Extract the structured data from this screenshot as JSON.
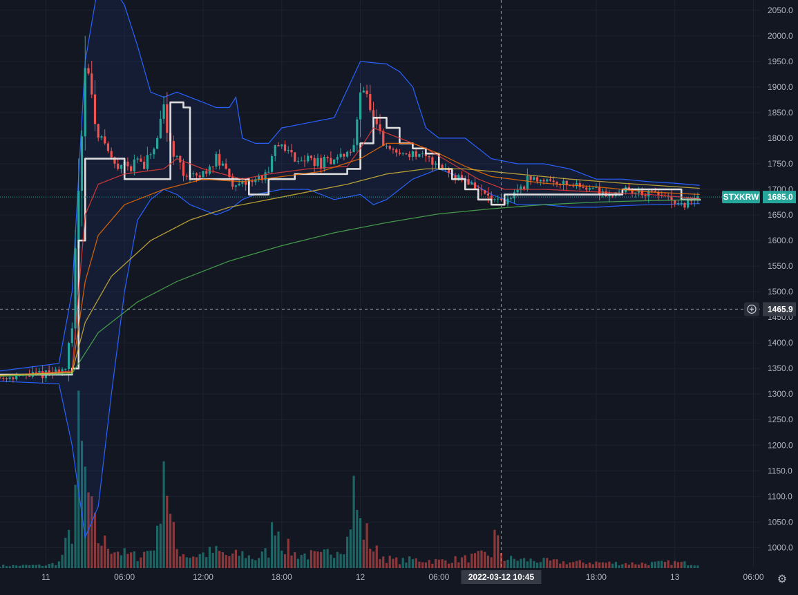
{
  "symbol": "STXKRW",
  "last_price_label": "1685.0",
  "crosshair": {
    "price_label": "1465.9",
    "time_label": "2022-03-12   10:45",
    "time_hours": 34.75
  },
  "colors": {
    "bg": "#131722",
    "grid": "#1e2230",
    "up": "#26a69a",
    "down": "#ef5350",
    "bb": "#2962ff",
    "symbol_badge": "#26a69a"
  },
  "icons": {
    "settings": "gear-icon",
    "crosshair_add": "plus-circle-icon"
  },
  "chart_data": {
    "type": "candlestick",
    "price_axis": {
      "ylim": [
        960,
        2070
      ],
      "ticks": [
        "2050.0",
        "2000.0",
        "1950.0",
        "1900.0",
        "1850.0",
        "1800.0",
        "1750.0",
        "1700.0",
        "1650.0",
        "1600.0",
        "1550.0",
        "1500.0",
        "1450.0",
        "1400.0",
        "1350.0",
        "1300.0",
        "1250.0",
        "1200.0",
        "1150.0",
        "1100.0",
        "1050.0",
        "1000.0"
      ],
      "tick_values": [
        2050,
        2000,
        1950,
        1900,
        1850,
        1800,
        1750,
        1700,
        1650,
        1600,
        1550,
        1500,
        1450,
        1400,
        1350,
        1300,
        1250,
        1200,
        1150,
        1100,
        1050,
        1000
      ]
    },
    "time_axis": {
      "xlim": [
        -3.5,
        54.5
      ],
      "ticks": [
        "11",
        "06:00",
        "12:00",
        "18:00",
        "12",
        "06:00",
        "18:00",
        "13",
        "06:00"
      ],
      "tick_hours": [
        0,
        6,
        12,
        18,
        24,
        30,
        42,
        48,
        54
      ]
    },
    "price_path": [
      [
        -3.5,
        1332
      ],
      [
        0,
        1340
      ],
      [
        1,
        1345
      ],
      [
        1.5,
        1350
      ],
      [
        2,
        1420
      ],
      [
        2.5,
        1720
      ],
      [
        3,
        1960
      ],
      [
        3.3,
        1920
      ],
      [
        3.6,
        1850
      ],
      [
        4,
        1810
      ],
      [
        4.5,
        1790
      ],
      [
        5,
        1760
      ],
      [
        5.5,
        1740
      ],
      [
        6,
        1760
      ],
      [
        6.5,
        1740
      ],
      [
        7,
        1760
      ],
      [
        7.5,
        1740
      ],
      [
        8,
        1770
      ],
      [
        8.5,
        1790
      ],
      [
        9,
        1860
      ],
      [
        9.4,
        1800
      ],
      [
        10,
        1760
      ],
      [
        10.5,
        1730
      ],
      [
        11,
        1730
      ],
      [
        11.5,
        1720
      ],
      [
        12,
        1730
      ],
      [
        13,
        1760
      ],
      [
        14,
        1730
      ],
      [
        14.5,
        1700
      ],
      [
        15,
        1710
      ],
      [
        16,
        1720
      ],
      [
        17,
        1730
      ],
      [
        17.5,
        1780
      ],
      [
        18,
        1790
      ],
      [
        19,
        1760
      ],
      [
        20,
        1760
      ],
      [
        21,
        1750
      ],
      [
        22,
        1760
      ],
      [
        23,
        1770
      ],
      [
        23.5,
        1780
      ],
      [
        24,
        1910
      ],
      [
        24.5,
        1880
      ],
      [
        25,
        1830
      ],
      [
        25.5,
        1800
      ],
      [
        26,
        1780
      ],
      [
        27,
        1770
      ],
      [
        28,
        1770
      ],
      [
        29,
        1760
      ],
      [
        30,
        1750
      ],
      [
        31,
        1730
      ],
      [
        32,
        1720
      ],
      [
        33,
        1700
      ],
      [
        34,
        1680
      ],
      [
        35,
        1670
      ],
      [
        36,
        1700
      ],
      [
        37,
        1720
      ],
      [
        38,
        1720
      ],
      [
        39,
        1715
      ],
      [
        40,
        1710
      ],
      [
        41,
        1705
      ],
      [
        42,
        1700
      ],
      [
        43,
        1690
      ],
      [
        44,
        1700
      ],
      [
        45,
        1695
      ],
      [
        46,
        1690
      ],
      [
        47,
        1690
      ],
      [
        48,
        1670
      ],
      [
        48.5,
        1665
      ],
      [
        49,
        1673
      ],
      [
        49.5,
        1680
      ],
      [
        49.9,
        1685
      ]
    ],
    "series": [
      {
        "values_path": [
          [
            -3.5,
            1338
          ],
          [
            2,
            1350
          ],
          [
            2.5,
            1600
          ],
          [
            3,
            1760
          ],
          [
            5,
            1760
          ],
          [
            6,
            1720
          ],
          [
            9,
            1720
          ],
          [
            9.5,
            1870
          ],
          [
            10.5,
            1860
          ],
          [
            11,
            1720
          ],
          [
            15,
            1720
          ],
          [
            15.5,
            1690
          ],
          [
            17,
            1720
          ],
          [
            18,
            1720
          ],
          [
            19,
            1730
          ],
          [
            23,
            1740
          ],
          [
            24,
            1790
          ],
          [
            25,
            1840
          ],
          [
            26,
            1820
          ],
          [
            27,
            1790
          ],
          [
            28,
            1780
          ],
          [
            29,
            1770
          ],
          [
            30,
            1740
          ],
          [
            31,
            1720
          ],
          [
            32,
            1700
          ],
          [
            33,
            1680
          ],
          [
            34,
            1670
          ],
          [
            35,
            1690
          ],
          [
            36,
            1690
          ],
          [
            40,
            1690
          ],
          [
            43,
            1690
          ],
          [
            44,
            1700
          ],
          [
            48,
            1700
          ],
          [
            48.5,
            1680
          ],
          [
            49.9,
            1678
          ]
        ],
        "color": "#e8e8e8",
        "step": true
      },
      {
        "values_path": [
          [
            -3.5,
            1336
          ],
          [
            2,
            1345
          ],
          [
            2.5,
            1500
          ],
          [
            3,
            1650
          ],
          [
            4,
            1710
          ],
          [
            6,
            1730
          ],
          [
            9,
            1740
          ],
          [
            10,
            1760
          ],
          [
            12,
            1740
          ],
          [
            15,
            1720
          ],
          [
            17,
            1730
          ],
          [
            20,
            1740
          ],
          [
            23,
            1745
          ],
          [
            24,
            1780
          ],
          [
            25,
            1820
          ],
          [
            27,
            1800
          ],
          [
            29,
            1780
          ],
          [
            31,
            1750
          ],
          [
            33,
            1720
          ],
          [
            35,
            1700
          ],
          [
            38,
            1700
          ],
          [
            42,
            1695
          ],
          [
            46,
            1690
          ],
          [
            49.9,
            1682
          ]
        ],
        "color": "#e53935"
      },
      {
        "values_path": [
          [
            -3.5,
            1336
          ],
          [
            2,
            1343
          ],
          [
            3,
            1520
          ],
          [
            4,
            1610
          ],
          [
            6,
            1670
          ],
          [
            9,
            1700
          ],
          [
            12,
            1720
          ],
          [
            15,
            1715
          ],
          [
            18,
            1725
          ],
          [
            21,
            1735
          ],
          [
            24,
            1760
          ],
          [
            26,
            1790
          ],
          [
            28,
            1790
          ],
          [
            30,
            1770
          ],
          [
            32,
            1745
          ],
          [
            34,
            1725
          ],
          [
            38,
            1712
          ],
          [
            42,
            1705
          ],
          [
            46,
            1695
          ],
          [
            49.9,
            1690
          ]
        ],
        "color": "#ef6c00"
      },
      {
        "values_path": [
          [
            -3.5,
            1337
          ],
          [
            2,
            1342
          ],
          [
            3,
            1440
          ],
          [
            5,
            1530
          ],
          [
            8,
            1600
          ],
          [
            11,
            1640
          ],
          [
            14,
            1665
          ],
          [
            17,
            1680
          ],
          [
            20,
            1695
          ],
          [
            23,
            1710
          ],
          [
            26,
            1730
          ],
          [
            29,
            1740
          ],
          [
            32,
            1740
          ],
          [
            36,
            1730
          ],
          [
            40,
            1720
          ],
          [
            44,
            1712
          ],
          [
            49.9,
            1702
          ]
        ],
        "color": "#d4b53a"
      },
      {
        "values_path": [
          [
            -3.5,
            1335
          ],
          [
            2,
            1340
          ],
          [
            4,
            1420
          ],
          [
            7,
            1480
          ],
          [
            10,
            1520
          ],
          [
            14,
            1560
          ],
          [
            18,
            1590
          ],
          [
            22,
            1615
          ],
          [
            26,
            1635
          ],
          [
            30,
            1652
          ],
          [
            34,
            1662
          ],
          [
            38,
            1670
          ],
          [
            42,
            1675
          ],
          [
            46,
            1678
          ],
          [
            49.9,
            1680
          ]
        ],
        "color": "#4caf50"
      }
    ],
    "bollinger": {
      "upper": [
        [
          -3.5,
          1345
        ],
        [
          1,
          1360
        ],
        [
          2,
          1500
        ],
        [
          3,
          1950
        ],
        [
          4,
          2100
        ],
        [
          5,
          2100
        ],
        [
          6,
          2060
        ],
        [
          7,
          1980
        ],
        [
          8,
          1890
        ],
        [
          9,
          1880
        ],
        [
          10,
          1890
        ],
        [
          11,
          1880
        ],
        [
          12,
          1870
        ],
        [
          13,
          1860
        ],
        [
          14,
          1860
        ],
        [
          14.5,
          1880
        ],
        [
          15,
          1800
        ],
        [
          16,
          1790
        ],
        [
          17,
          1790
        ],
        [
          18,
          1820
        ],
        [
          20,
          1830
        ],
        [
          22,
          1840
        ],
        [
          24,
          1950
        ],
        [
          26,
          1945
        ],
        [
          27,
          1930
        ],
        [
          28,
          1900
        ],
        [
          29,
          1820
        ],
        [
          30,
          1800
        ],
        [
          32,
          1800
        ],
        [
          34,
          1760
        ],
        [
          36,
          1750
        ],
        [
          38,
          1750
        ],
        [
          40,
          1740
        ],
        [
          42,
          1720
        ],
        [
          44,
          1720
        ],
        [
          46,
          1715
        ],
        [
          48,
          1712
        ],
        [
          49.9,
          1708
        ]
      ],
      "lower": [
        [
          -3.5,
          1325
        ],
        [
          1,
          1320
        ],
        [
          2,
          1200
        ],
        [
          3,
          1020
        ],
        [
          4,
          1080
        ],
        [
          5,
          1300
        ],
        [
          6,
          1500
        ],
        [
          7,
          1640
        ],
        [
          8,
          1680
        ],
        [
          9,
          1700
        ],
        [
          10,
          1690
        ],
        [
          11,
          1670
        ],
        [
          12,
          1660
        ],
        [
          13,
          1650
        ],
        [
          14,
          1660
        ],
        [
          15,
          1680
        ],
        [
          16,
          1690
        ],
        [
          18,
          1700
        ],
        [
          20,
          1700
        ],
        [
          22,
          1680
        ],
        [
          24,
          1690
        ],
        [
          25,
          1670
        ],
        [
          26,
          1680
        ],
        [
          28,
          1720
        ],
        [
          30,
          1740
        ],
        [
          32,
          1720
        ],
        [
          34,
          1690
        ],
        [
          36,
          1670
        ],
        [
          38,
          1670
        ],
        [
          40,
          1665
        ],
        [
          42,
          1665
        ],
        [
          44,
          1668
        ],
        [
          46,
          1670
        ],
        [
          49.9,
          1672
        ]
      ]
    },
    "volume_profile": [
      [
        -3.5,
        5
      ],
      [
        0,
        6
      ],
      [
        1,
        12
      ],
      [
        2,
        80
      ],
      [
        2.5,
        270
      ],
      [
        3,
        190
      ],
      [
        3.5,
        110
      ],
      [
        4,
        60
      ],
      [
        5,
        45
      ],
      [
        6,
        30
      ],
      [
        7,
        25
      ],
      [
        8,
        40
      ],
      [
        8.5,
        65
      ],
      [
        9,
        260
      ],
      [
        9.5,
        100
      ],
      [
        10,
        40
      ],
      [
        11,
        25
      ],
      [
        12,
        30
      ],
      [
        13,
        35
      ],
      [
        14,
        25
      ],
      [
        15,
        30
      ],
      [
        16,
        20
      ],
      [
        17,
        35
      ],
      [
        17.5,
        115
      ],
      [
        18,
        55
      ],
      [
        19,
        30
      ],
      [
        20,
        28
      ],
      [
        21,
        25
      ],
      [
        22,
        40
      ],
      [
        23,
        60
      ],
      [
        23.5,
        160
      ],
      [
        24,
        90
      ],
      [
        24.5,
        70
      ],
      [
        25,
        40
      ],
      [
        26,
        20
      ],
      [
        27,
        15
      ],
      [
        28,
        18
      ],
      [
        30,
        15
      ],
      [
        32,
        20
      ],
      [
        34,
        30
      ],
      [
        34.2,
        70
      ],
      [
        35,
        20
      ],
      [
        36,
        18
      ],
      [
        38,
        15
      ],
      [
        40,
        12
      ],
      [
        42,
        12
      ],
      [
        44,
        10
      ],
      [
        46,
        10
      ],
      [
        48,
        12
      ],
      [
        49.9,
        8
      ]
    ]
  }
}
